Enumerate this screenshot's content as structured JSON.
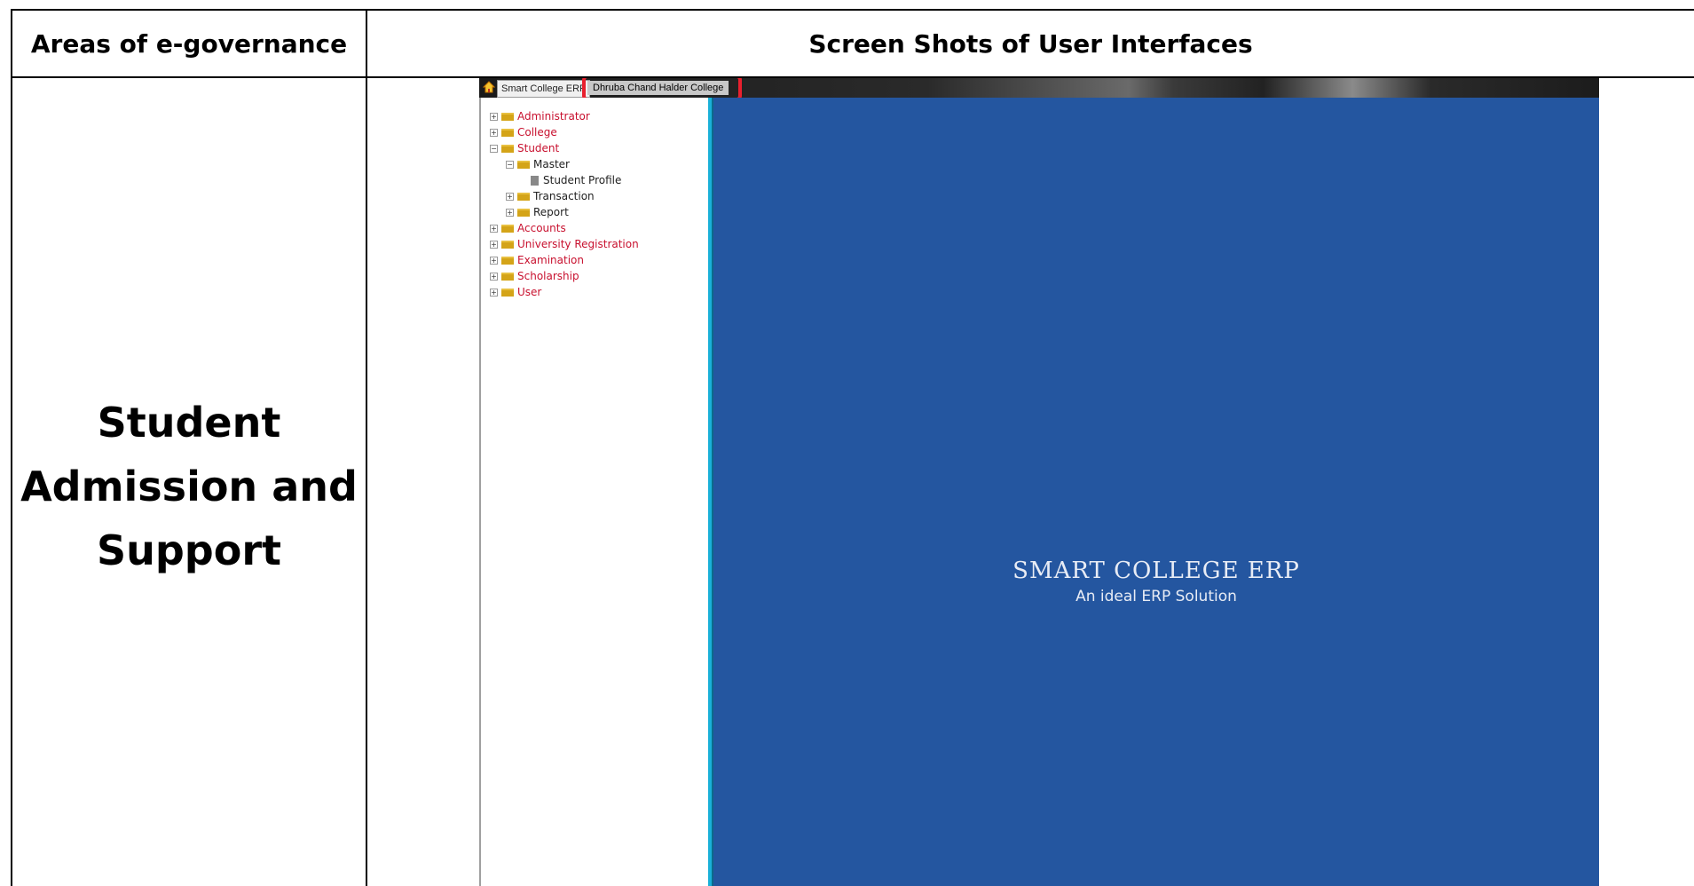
{
  "table": {
    "header_left": "Areas of e-governance",
    "header_right": "Screen Shots of User Interfaces",
    "row_label_lines": [
      "Student",
      "Admission and",
      "Support"
    ]
  },
  "erp": {
    "app_tab": "Smart College ERP",
    "college_tab": "Dhruba Chand Halder College",
    "tree": [
      {
        "label": "Administrator",
        "level": 0,
        "state": "collapsed"
      },
      {
        "label": "College",
        "level": 0,
        "state": "collapsed"
      },
      {
        "label": "Student",
        "level": 0,
        "state": "expanded"
      },
      {
        "label": "Master",
        "level": 1,
        "state": "expanded"
      },
      {
        "label": "Student Profile",
        "level": 2,
        "state": "leaf"
      },
      {
        "label": "Transaction",
        "level": 1,
        "state": "collapsed"
      },
      {
        "label": "Report",
        "level": 1,
        "state": "collapsed"
      },
      {
        "label": "Accounts",
        "level": 0,
        "state": "collapsed"
      },
      {
        "label": "University Registration",
        "level": 0,
        "state": "collapsed"
      },
      {
        "label": "Examination",
        "level": 0,
        "state": "collapsed"
      },
      {
        "label": "Scholarship",
        "level": 0,
        "state": "collapsed"
      },
      {
        "label": "User",
        "level": 0,
        "state": "collapsed"
      }
    ],
    "brand_title": "SMART COLLEGE ERP",
    "brand_subtitle": "An ideal ERP Solution",
    "colors": {
      "main_background": "#2456a0",
      "splitter": "#1ab0d8",
      "highlight_box": "#e8202e",
      "tree_root_text": "#c8102e"
    }
  }
}
